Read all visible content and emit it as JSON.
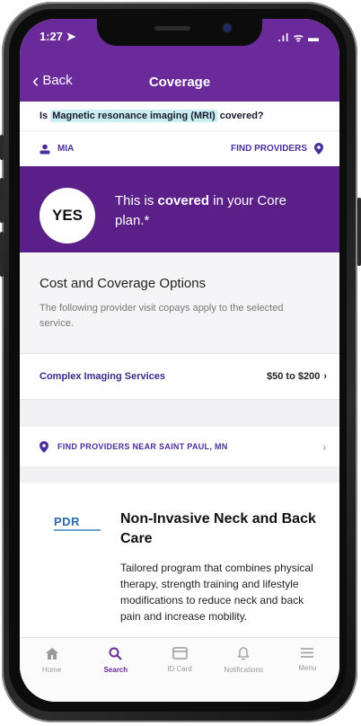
{
  "status": {
    "time": "1:27",
    "signal": ".ıl ᯤ ▬"
  },
  "header": {
    "back_label": "Back",
    "title": "Coverage"
  },
  "question": {
    "prefix": "Is",
    "procedure": "Magnetic resonance imaging (MRI)",
    "suffix": "covered?"
  },
  "member": {
    "name": "MIA",
    "find_providers_label": "FIND PROVIDERS"
  },
  "coverage_banner": {
    "answer": "YES",
    "text_before": "This is ",
    "text_bold": "covered",
    "text_after": " in your Core plan.*"
  },
  "cost_section": {
    "title": "Cost and Coverage Options",
    "description": "The following provider visit copays apply to the selected service."
  },
  "service": {
    "name": "Complex Imaging Services",
    "price": "$50 to $200"
  },
  "near": {
    "label": "FIND PROVIDERS NEAR SAINT PAUL, MN"
  },
  "program": {
    "logo_text": "PDR",
    "title": "Non-Invasive Neck and Back Care",
    "description": "Tailored program that combines physical therapy, strength training and lifestyle modifications to reduce neck and back pain and increase mobility."
  },
  "tabs": [
    {
      "label": "Home",
      "icon": "home-icon"
    },
    {
      "label": "Search",
      "icon": "search-icon"
    },
    {
      "label": "ID Card",
      "icon": "id-card-icon"
    },
    {
      "label": "Notifications",
      "icon": "bell-icon"
    },
    {
      "label": "Menu",
      "icon": "menu-icon"
    }
  ],
  "colors": {
    "brand_purple": "#6a2a9a",
    "banner_purple": "#5b1f88",
    "highlight": "#c9eff2",
    "link_blue": "#4a2e9a"
  }
}
